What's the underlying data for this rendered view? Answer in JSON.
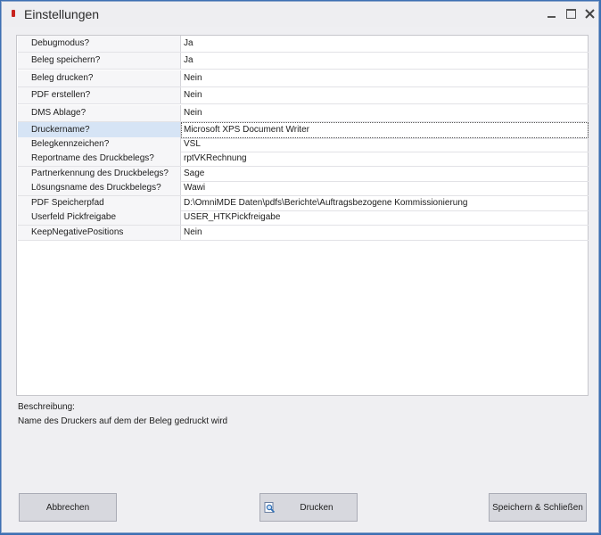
{
  "window": {
    "title": "Einstellungen",
    "accent_color": "#c8231e"
  },
  "properties": [
    {
      "name": "Debugmodus?",
      "value": "Ja"
    },
    {
      "name": "Beleg speichern?",
      "value": "Ja"
    },
    {
      "name": "Beleg drucken?",
      "value": "Nein"
    },
    {
      "name": "PDF erstellen?",
      "value": "Nein"
    },
    {
      "name": "DMS Ablage?",
      "value": "Nein"
    },
    {
      "name": "Druckername?",
      "value": "Microsoft XPS Document Writer"
    },
    {
      "name": "Belegkennzeichen?",
      "value": "VSL"
    },
    {
      "name": "Reportname des Druckbelegs?",
      "value": "rptVKRechnung"
    },
    {
      "name": "Partnerkennung des Druckbelegs?",
      "value": "Sage"
    },
    {
      "name": "Lösungsname des Druckbelegs?",
      "value": "Wawi"
    },
    {
      "name": "PDF Speicherpfad",
      "value": "D:\\OmniMDE Daten\\pdfs\\Berichte\\Auftragsbezogene Kommissionierung"
    },
    {
      "name": "Userfeld Pickfreigabe",
      "value": "USER_HTKPickfreigabe"
    },
    {
      "name": "KeepNegativePositions",
      "value": "Nein"
    }
  ],
  "description": {
    "title": "Beschreibung:",
    "text": "Name des Druckers auf dem der Beleg gedruckt wird"
  },
  "buttons": {
    "cancel": "Abbrechen",
    "print": "Drucken",
    "save": "Speichern & Schließen"
  }
}
